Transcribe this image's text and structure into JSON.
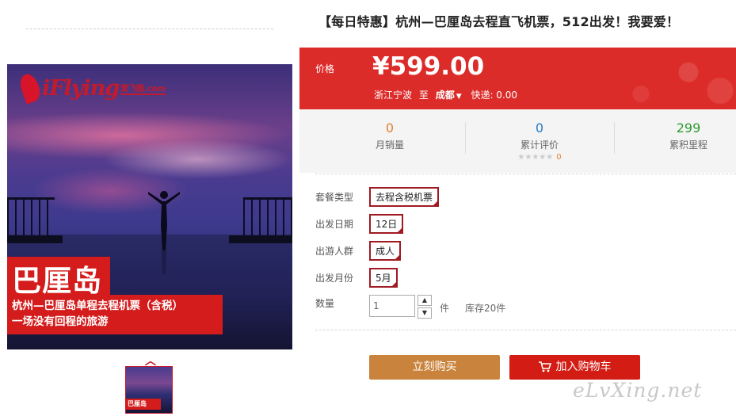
{
  "product": {
    "title": "【每日特惠】杭州—巴厘岛去程直飞机票，512出发！我要爱！",
    "image": {
      "logo_text": "iFlying",
      "logo_sub": "爱飞翔.com",
      "banner_title": "巴厘岛",
      "banner_line1": "杭州—巴厘岛单程去程机票（含税）",
      "banner_line2": "一场没有回程的旅游",
      "thumb_label": "巴厘岛"
    }
  },
  "price": {
    "label": "价格",
    "value": "¥599.00",
    "origin": "浙江宁波",
    "to": "至",
    "destination": "成都",
    "shipping": "快递: 0.00"
  },
  "stats": {
    "monthly_sales": {
      "value": "0",
      "label": "月销量"
    },
    "reviews": {
      "value": "0",
      "label": "累计评价",
      "stars": "★★★★★",
      "stars_count": "0"
    },
    "points": {
      "value": "299",
      "label": "累积里程"
    }
  },
  "options": {
    "package": {
      "label": "套餐类型",
      "value": "去程含税机票"
    },
    "date": {
      "label": "出发日期",
      "value": "12日"
    },
    "people": {
      "label": "出游人群",
      "value": "成人"
    },
    "month": {
      "label": "出发月份",
      "value": "5月"
    }
  },
  "quantity": {
    "label": "数量",
    "value": "1",
    "unit": "件",
    "stock": "库存20件"
  },
  "actions": {
    "buy_now": "立刻购买",
    "add_to_cart": "加入购物车"
  },
  "watermark": "eLvXing.net",
  "colors": {
    "accent_red": "#dc2c2a",
    "buy_orange": "#c9833c",
    "cart_red": "#d31c13",
    "tag_border": "#a01a22"
  }
}
